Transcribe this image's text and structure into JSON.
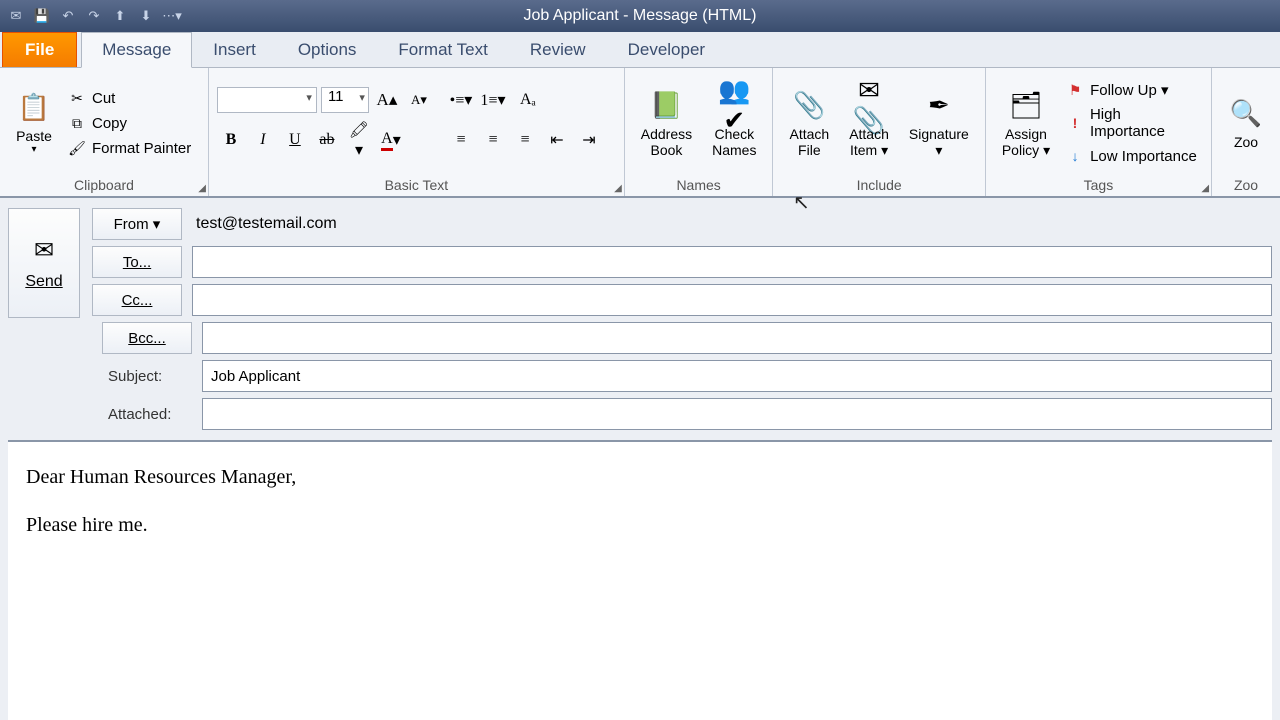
{
  "window": {
    "title": "Job Applicant  -  Message (HTML)"
  },
  "tabs": {
    "file": "File",
    "items": [
      "Message",
      "Insert",
      "Options",
      "Format Text",
      "Review",
      "Developer"
    ],
    "active": 0
  },
  "ribbon": {
    "clipboard": {
      "label": "Clipboard",
      "paste": "Paste",
      "cut": "Cut",
      "copy": "Copy",
      "format_painter": "Format Painter"
    },
    "basic_text": {
      "label": "Basic Text",
      "font_name": "",
      "font_size": "11"
    },
    "names": {
      "label": "Names",
      "address_book": "Address\nBook",
      "check_names": "Check\nNames"
    },
    "include": {
      "label": "Include",
      "attach_file": "Attach\nFile",
      "attach_item": "Attach\nItem ▾",
      "signature": "Signature\n▾"
    },
    "tags": {
      "label": "Tags",
      "assign_policy": "Assign\nPolicy ▾",
      "follow_up": "Follow Up ▾",
      "high_importance": "High Importance",
      "low_importance": "Low Importance"
    },
    "zoom": {
      "label": "Zoo",
      "zoom": "Zoo"
    }
  },
  "compose": {
    "send": "Send",
    "from_label": "From ▾",
    "from_value": "test@testemail.com",
    "to_label": "To...",
    "to_value": "",
    "cc_label": "Cc...",
    "cc_value": "",
    "bcc_label": "Bcc...",
    "bcc_value": "",
    "subject_label": "Subject:",
    "subject_value": "Job Applicant",
    "attached_label": "Attached:",
    "attached_value": ""
  },
  "body": {
    "paragraphs": [
      "Dear Human Resources Manager,",
      "Please hire me."
    ]
  }
}
